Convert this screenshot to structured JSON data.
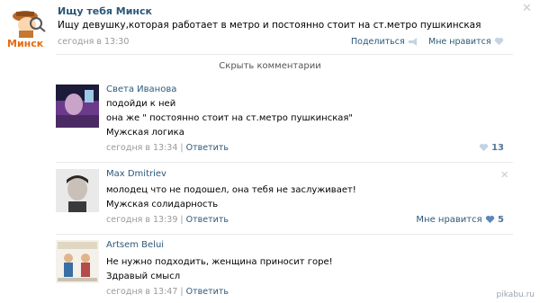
{
  "post": {
    "group_name": "Ищу тебя Минск",
    "logo_text": "Минск",
    "text": "Ищу девушку,которая работает в метро и постоянно стоит на ст.метро пушкинская",
    "date": "сегодня в 13:30",
    "share_label": "Поделиться",
    "like_label": "Мне нравится"
  },
  "hide_comments_label": "Скрыть комментарии",
  "comments": [
    {
      "author": "Света Иванова",
      "lines": [
        "подойди к ней",
        "она же \" постоянно стоит на ст.метро пушкинская\"",
        "Мужская логика"
      ],
      "date": "сегодня в 13:34",
      "separator": "|",
      "reply_label": "Ответить",
      "like_label": "",
      "likes": "13"
    },
    {
      "author": "Max Dmitriev",
      "lines": [
        "молодец что не подошел, она тебя не заслуживает!",
        "Мужская солидарность"
      ],
      "date": "сегодня в 13:39",
      "separator": "|",
      "reply_label": "Ответить",
      "like_label": "Мне нравится",
      "likes": "5"
    },
    {
      "author": "Artsem Belui",
      "lines": [
        "Не нужно подходить, женщина приносит горе!",
        "Здравый смысл"
      ],
      "date": "сегодня в 13:47",
      "separator": "|",
      "reply_label": "Ответить",
      "like_label": "",
      "likes": ""
    }
  ],
  "watermark": "pikabu.ru",
  "colors": {
    "link": "#2b587a",
    "muted": "#999999",
    "like_icon": "#c5d3e2",
    "separator": "#e7eaed"
  }
}
